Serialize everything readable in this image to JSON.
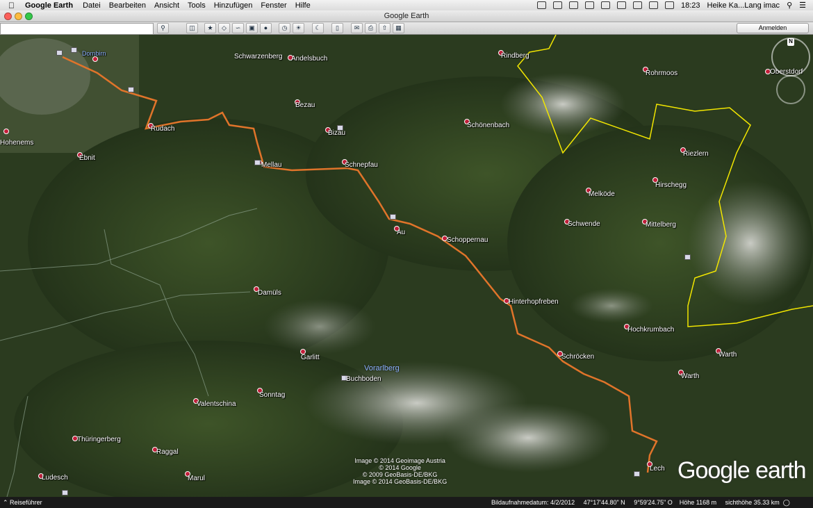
{
  "menubar": {
    "app": "Google Earth",
    "items": [
      "Datei",
      "Bearbeiten",
      "Ansicht",
      "Tools",
      "Hinzufügen",
      "Fenster",
      "Hilfe"
    ],
    "time": "18:23",
    "user": "Heike Ka...Lang imac"
  },
  "window": {
    "title": "Google Earth"
  },
  "toolbar": {
    "search_value": "",
    "signin_label": "Anmelden",
    "buttons": [
      "search",
      "sidebar",
      "placemark",
      "polygon",
      "path",
      "overlay",
      "tour",
      "history",
      "sun",
      "planets",
      "ruler",
      "email",
      "print",
      "save-image",
      "maps"
    ]
  },
  "map": {
    "places": [
      {
        "name": "Dornbirn",
        "kind": "city"
      },
      {
        "name": "Schwarzenberg",
        "kind": "village"
      },
      {
        "name": "Andelsbuch",
        "kind": "village"
      },
      {
        "name": "Bezau",
        "kind": "village"
      },
      {
        "name": "Bizau",
        "kind": "village"
      },
      {
        "name": "Rudach",
        "kind": "village"
      },
      {
        "name": "Hohenems",
        "kind": "village"
      },
      {
        "name": "Ebnit",
        "kind": "village"
      },
      {
        "name": "Mellau",
        "kind": "village"
      },
      {
        "name": "Schnepfau",
        "kind": "village"
      },
      {
        "name": "Schönenbach",
        "kind": "village"
      },
      {
        "name": "Rindberg",
        "kind": "village"
      },
      {
        "name": "Rohrmoos",
        "kind": "village"
      },
      {
        "name": "Oberstdorf",
        "kind": "village"
      },
      {
        "name": "Riezlern",
        "kind": "village"
      },
      {
        "name": "Hirschegg",
        "kind": "village"
      },
      {
        "name": "Melköde",
        "kind": "village"
      },
      {
        "name": "Schwende",
        "kind": "village"
      },
      {
        "name": "Mittelberg",
        "kind": "village"
      },
      {
        "name": "Au",
        "kind": "village"
      },
      {
        "name": "Schoppernau",
        "kind": "village"
      },
      {
        "name": "Damüls",
        "kind": "village"
      },
      {
        "name": "Hinterhopfreben",
        "kind": "village"
      },
      {
        "name": "Hochkrumbach",
        "kind": "village"
      },
      {
        "name": "Schröcken",
        "kind": "village"
      },
      {
        "name": "Warth",
        "kind": "village"
      },
      {
        "name": "Warth",
        "kind": "village"
      },
      {
        "name": "Garlitt",
        "kind": "village"
      },
      {
        "name": "Buchboden",
        "kind": "village"
      },
      {
        "name": "Sonntag",
        "kind": "village"
      },
      {
        "name": "Valentschina",
        "kind": "village"
      },
      {
        "name": "Thüringerberg",
        "kind": "village"
      },
      {
        "name": "Raggal",
        "kind": "village"
      },
      {
        "name": "Marul",
        "kind": "village"
      },
      {
        "name": "Ludesch",
        "kind": "village"
      },
      {
        "name": "Lech",
        "kind": "village"
      }
    ],
    "region_label": "Vorarlberg",
    "route_color": "#e0742a",
    "border_color": "#f2e600",
    "copyright": [
      "Image © 2014 Geoimage Austria",
      "© 2014 Google",
      "© 2009 GeoBasis-DE/BKG",
      "Image © 2014 GeoBasis-DE/BKG"
    ],
    "logo": {
      "google": "Google",
      "earth": "earth"
    },
    "compass_n": "N"
  },
  "statusbar": {
    "guide_label": "Reiseführer",
    "imagery_date": "Bildaufnahmedatum: 4/2/2012",
    "lat": "47°17'44.80\" N",
    "lon": "9°59'24.75\" O",
    "elevation": "Höhe  1168 m",
    "eye_alt": "sichthöhe  35.33 km"
  }
}
